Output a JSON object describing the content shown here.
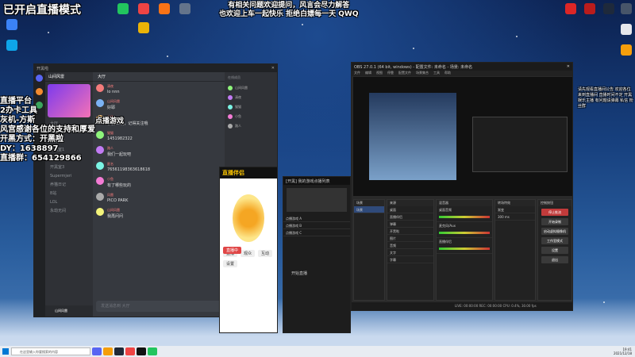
{
  "overlay": {
    "title": "已开启直播模式",
    "announce1": "有相关问题欢迎提问，风言会尽力解答",
    "announce2": "也欢迎上车一起快乐 拒绝白嫖每一天 QWQ",
    "left_lines": [
      "直播平台",
      "2办卡工具",
      "灰机-方斯",
      "风宫感谢各位的支持和厚爱",
      "开黑方式：开黑啦",
      "DY：1638897",
      "直播群：654129866"
    ],
    "left_inline": "点播游戏",
    "right_text": "请先观看直播间公告 欢迎各位来到直播间 直播时间不定 开黑 娱乐主播 有问题请弹幕 私信 粉丝群"
  },
  "discord": {
    "window_title": "开黑啦",
    "server": "山间风雷",
    "channel_header": "大厅",
    "channels": [
      "大厅",
      "直播间1",
      "直播间2",
      "开黑室1",
      "开黑室2",
      "开黑室3",
      "Supermjeri",
      "养猫日记",
      "B站",
      "LOL",
      "永劫无间"
    ],
    "user": "山间风雷",
    "messages": [
      {
        "name": "清夜",
        "text": "lo nnn"
      },
      {
        "name": "山间风雷",
        "text": "好耶"
      },
      {
        "name": "风雷",
        "text": "小鹿dd们，记得关注哦"
      },
      {
        "name": "猫猫",
        "text": "1451982322"
      },
      {
        "name": "路人",
        "text": "我们一起玩吧"
      },
      {
        "name": "匿名",
        "text": "76561198363618618"
      },
      {
        "name": "小鱼",
        "text": "有了哪些玩的"
      },
      {
        "name": "风雷",
        "text": "PICO PARK"
      },
      {
        "name": "山间风雷",
        "text": "我再问问"
      }
    ],
    "input_placeholder": "发送消息到 大厅",
    "members_header": "在线成员",
    "members": [
      "山间风雷",
      "清夜",
      "猫猫",
      "小鱼",
      "路人"
    ]
  },
  "assistant": {
    "title": "直播伴侣",
    "items": [
      "直播",
      "观众",
      "互动",
      "设置"
    ],
    "status": "直播中"
  },
  "playlist": {
    "title": "[开黑] 我的游戏点播列表",
    "items": [
      "点播游戏 A",
      "点播游戏 B",
      "点播游戏 C"
    ],
    "button": "开始直播"
  },
  "obs": {
    "title": "OBS 27.0.1 (64 bit, windows) - 配置文件: 未命名 - 场景: 未命名",
    "menu": [
      "文件",
      "编辑",
      "视图",
      "停靠",
      "配置文件",
      "场景集合",
      "工具",
      "帮助"
    ],
    "scenes_title": "场景",
    "scenes": [
      "场景"
    ],
    "sources_title": "来源",
    "sources": [
      "桌面",
      "直播伴侣",
      "弹幕",
      "开黑啦",
      "图片",
      "音频",
      "文字",
      "字幕"
    ],
    "mixer_title": "混音器",
    "mixer": [
      "桌面音频",
      "麦克风/Aux",
      "直播伴侣"
    ],
    "transitions_title": "转场特效",
    "transition": "渐变",
    "duration": "300 ms",
    "controls_title": "控制按钮",
    "controls": [
      "停止推流",
      "开始录制",
      "启动虚拟摄像机",
      "工作室模式",
      "设置",
      "退出"
    ],
    "status": "LIVE: 00:00:00  REC: 00:00:00  CPU: 0.4%, 30.00 fps"
  },
  "taskbar": {
    "search": "在这里输入你要搜索的内容",
    "time": "19:41",
    "date": "2021/12/18"
  }
}
